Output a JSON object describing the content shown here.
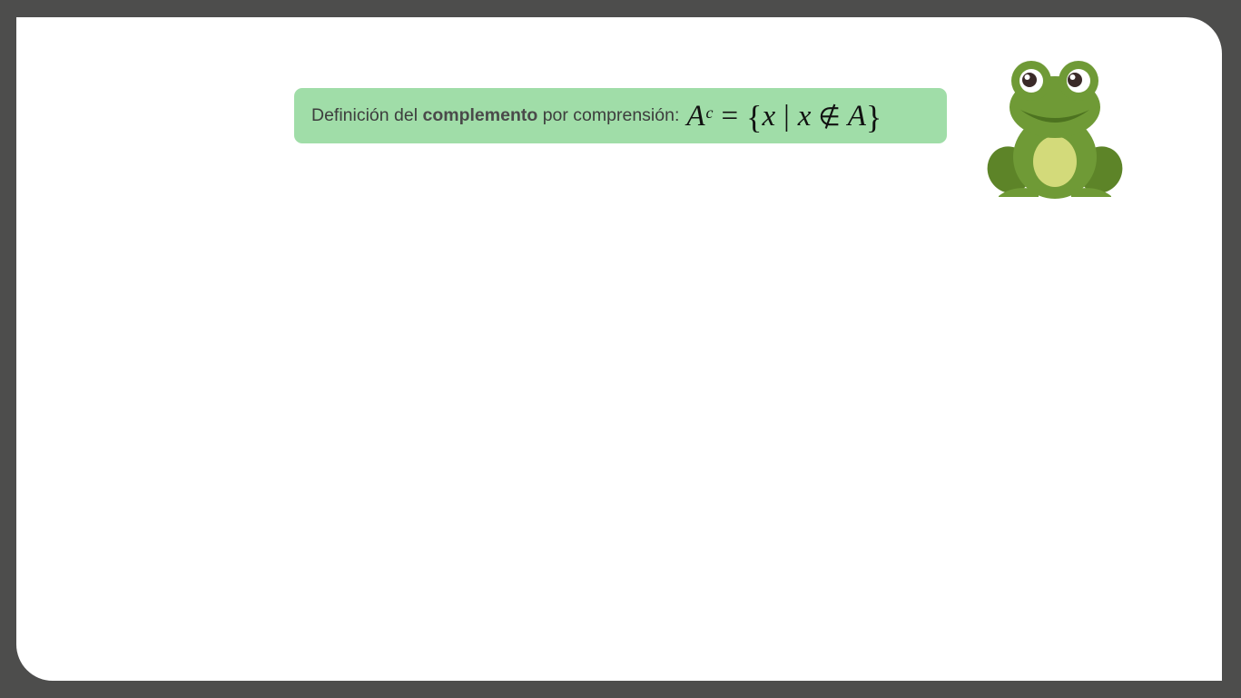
{
  "definition": {
    "prefix": "Definición del",
    "bold_word": "complemento",
    "suffix": "por comprensión:"
  },
  "formula": {
    "set": "A",
    "superscript": "c",
    "equals": "=",
    "open_brace": "{",
    "variable": "x",
    "separator": "|",
    "variable2": "x",
    "not_in": "∉",
    "set2": "A",
    "close_brace": "}"
  },
  "colors": {
    "frame": "#4d4d4c",
    "box": "#a0dda8",
    "frog_body": "#6f9a36",
    "frog_belly": "#d3da7a"
  },
  "icons": {
    "mascot": "frog-icon"
  }
}
